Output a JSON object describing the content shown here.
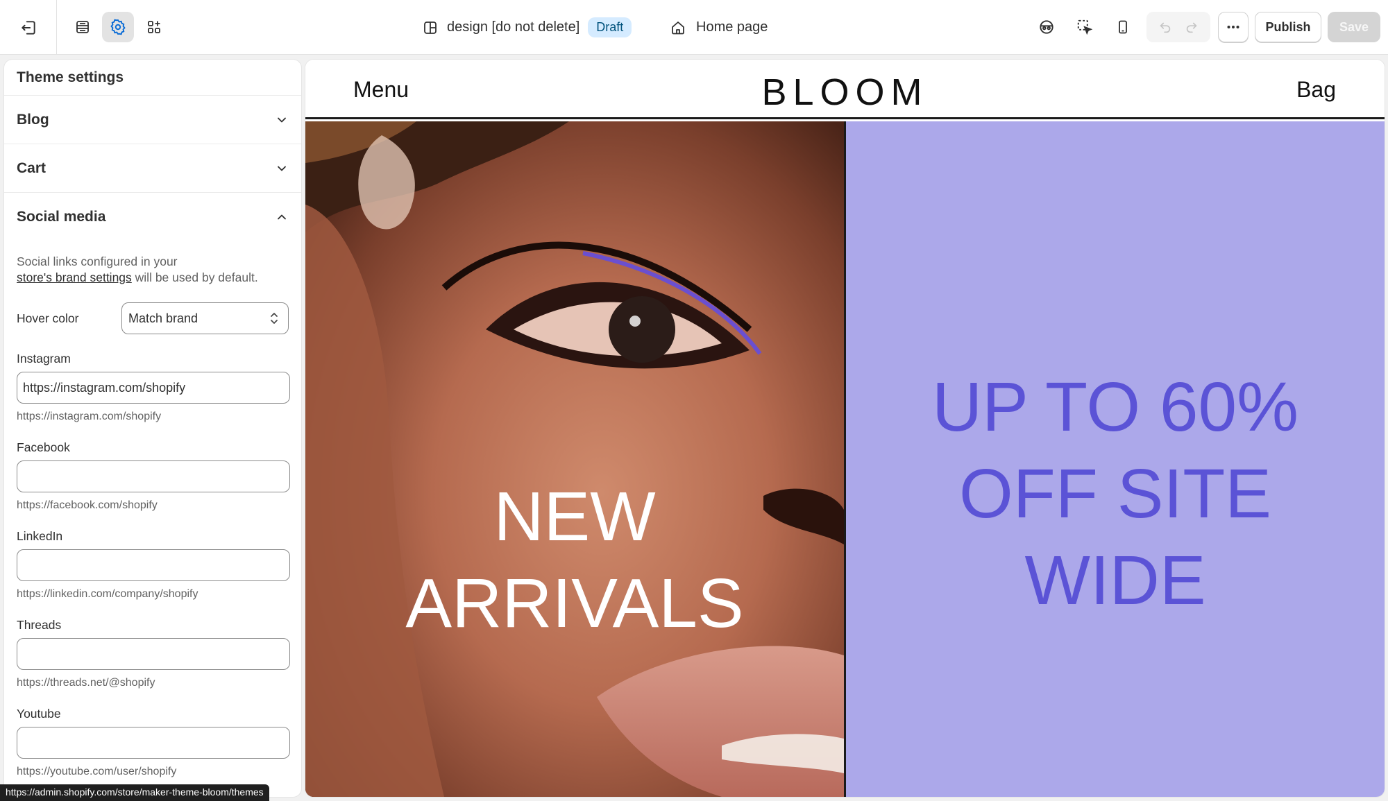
{
  "topbar": {
    "theme_name": "design [do not delete]",
    "status_badge": "Draft",
    "page_name": "Home page",
    "publish_label": "Publish",
    "save_label": "Save",
    "icons": {
      "exit": "exit-icon",
      "sections": "sections-icon",
      "settings": "gear-icon",
      "apps": "apps-icon",
      "theme": "layout-icon",
      "home": "home-icon",
      "sensitive_data": "mask-icon",
      "inspector": "cursor-select-icon",
      "mobile": "mobile-icon",
      "undo": "undo-icon",
      "redo": "redo-icon",
      "more": "more-icon"
    }
  },
  "sidebar": {
    "title": "Theme settings",
    "sections": [
      {
        "label": "Blog",
        "expanded": false
      },
      {
        "label": "Cart",
        "expanded": false
      },
      {
        "label": "Social media",
        "expanded": true
      }
    ],
    "social": {
      "help_prefix": "Social links configured in your",
      "help_link": "store's brand settings",
      "help_suffix": " will be used by default.",
      "hover_color_label": "Hover color",
      "hover_color_value": "Match brand",
      "fields": [
        {
          "label": "Instagram",
          "value": "https://instagram.com/shopify",
          "hint": "https://instagram.com/shopify"
        },
        {
          "label": "Facebook",
          "value": "",
          "hint": "https://facebook.com/shopify"
        },
        {
          "label": "LinkedIn",
          "value": "",
          "hint": "https://linkedin.com/company/shopify"
        },
        {
          "label": "Threads",
          "value": "",
          "hint": "https://threads.net/@shopify"
        },
        {
          "label": "Youtube",
          "value": "",
          "hint": "https://youtube.com/user/shopify"
        }
      ]
    }
  },
  "statusbar": {
    "url": "https://admin.shopify.com/store/maker-theme-bloom/themes"
  },
  "preview": {
    "header": {
      "menu": "Menu",
      "logo": "BLOOM",
      "bag": "Bag"
    },
    "left_promo": {
      "line1": "NEW",
      "line2": "ARRIVALS"
    },
    "right_promo": {
      "line1": "UP TO 60%",
      "line2": "OFF SITE",
      "line3": "WIDE"
    },
    "colors": {
      "promo_bg": "#aca8ea",
      "promo_text": "#5b53d6",
      "draft_badge": "#d5ebff"
    }
  }
}
